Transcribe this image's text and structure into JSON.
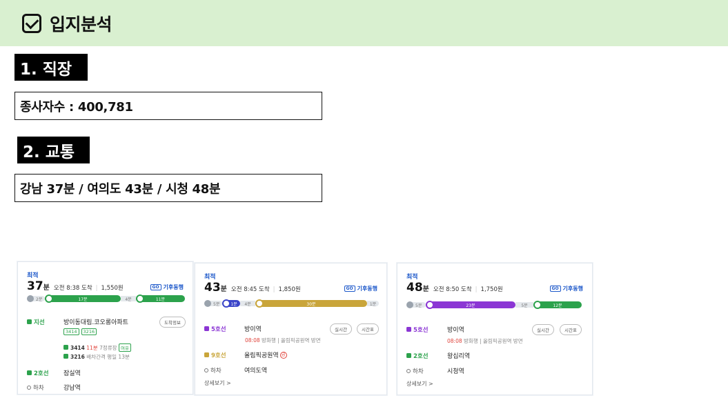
{
  "header": {
    "title": "입지분석"
  },
  "sections": {
    "work": {
      "label": "1. 직장",
      "text": "종사자수 : 400,781"
    },
    "transit": {
      "label": "2. 교통",
      "text": "강남 37분 / 여의도 43분 / 시청 48분"
    }
  },
  "cards": [
    {
      "best": "최적",
      "minutes": "37",
      "unit": "분",
      "arrival": "오전 8:38 도착",
      "fare": "1,550원",
      "after": "기후동행",
      "bar": {
        "walk": "2분",
        "first": "17분",
        "gap": "4분",
        "second": "11분"
      },
      "rows": {
        "bus_line": "지선",
        "bus_stop": "방이동대림.코오롱아파트",
        "bus_detail_button": "도착정보",
        "bus_tags": [
          "3414",
          "3216"
        ],
        "bus1_no": "3414",
        "bus1_time": "11분",
        "bus1_info": "7정류장",
        "bus1_badge": "여유",
        "bus2_no": "3216",
        "bus2_info": "배차간격 평일 13분",
        "line2": "2호선",
        "line2_station": "잠실역",
        "alight_label": "하차",
        "alight_station": "강남역"
      }
    },
    {
      "best": "최적",
      "minutes": "43",
      "unit": "분",
      "arrival": "오전 8:45 도착",
      "fare": "1,850원",
      "after": "기후동행",
      "bar": {
        "walk": "5분",
        "first": "1분",
        "gap1": "4분",
        "second": "30분",
        "end": "1분"
      },
      "rows": {
        "line5": "5호선",
        "line5_station": "방이역",
        "btn_realtime": "실시간",
        "btn_timetable": "시간표",
        "note_time": "08:08",
        "note_text": "방화행 | 올림픽공원역 방면",
        "line9": "9호선",
        "line9_station": "올림픽공원역",
        "express": "급",
        "alight_label": "하차",
        "alight_station": "여의도역",
        "more": "상세보기 >"
      }
    },
    {
      "best": "최적",
      "minutes": "48",
      "unit": "분",
      "arrival": "오전 8:50 도착",
      "fare": "1,750원",
      "after": "기후동행",
      "bar": {
        "walk": "5분",
        "first": "23분",
        "gap": "5분",
        "second": "12분"
      },
      "rows": {
        "line5": "5호선",
        "line5_station": "방이역",
        "btn_realtime": "실시간",
        "btn_timetable": "시간표",
        "note_time": "08:08",
        "note_text": "방화행 | 올림픽공원역 방면",
        "line2": "2호선",
        "line2_station": "왕십리역",
        "alight_label": "하차",
        "alight_station": "시청역",
        "more": "상세보기 >"
      }
    }
  ],
  "colors": {
    "line2": "#2ca24c",
    "line5": "#8b36d4",
    "line9": "#c9a53a",
    "bus_blue": "#3b45c9",
    "accent": "#1a56c9"
  }
}
